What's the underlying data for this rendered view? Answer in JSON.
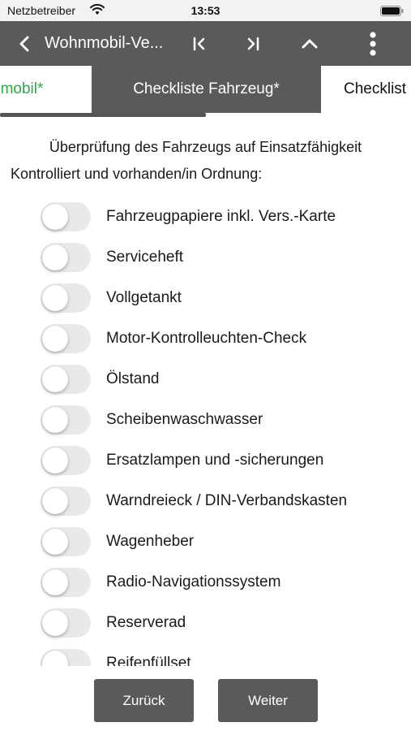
{
  "status_bar": {
    "carrier": "Netzbetreiber",
    "time": "13:53"
  },
  "toolbar": {
    "title": "Wohnmobil-Ve...",
    "icons": [
      "back-chevron-icon",
      "first-page-icon",
      "last-page-icon",
      "collapse-icon",
      "more-vertical-icon"
    ]
  },
  "tabs": [
    {
      "label": "nmobil*",
      "color": "#2ea84a"
    },
    {
      "label": "Checkliste Fahrzeug*",
      "selected": true
    },
    {
      "label": "Checklist"
    }
  ],
  "content": {
    "heading": "Überprüfung des Fahrzeugs auf Einsatzfähigkeit",
    "subheading": "Kontrolliert und vorhanden/in Ordnung:",
    "items": [
      {
        "label": "Fahrzeugpapiere inkl. Vers.-Karte",
        "checked": false
      },
      {
        "label": "Serviceheft",
        "checked": false
      },
      {
        "label": "Vollgetankt",
        "checked": false
      },
      {
        "label": "Motor-Kontrolleuchten-Check",
        "checked": false
      },
      {
        "label": "Ölstand",
        "checked": false
      },
      {
        "label": "Scheibenwaschwasser",
        "checked": false
      },
      {
        "label": "Ersatzlampen und -sicherungen",
        "checked": false
      },
      {
        "label": "Warndreieck / DIN-Verbandskasten",
        "checked": false
      },
      {
        "label": "Wagenheber",
        "checked": false
      },
      {
        "label": "Radio-Navigationssystem",
        "checked": false
      },
      {
        "label": "Reserverad",
        "checked": false
      },
      {
        "label": "Reifenfüllset",
        "checked": false
      }
    ]
  },
  "footer": {
    "back_label": "Zurück",
    "next_label": "Weiter"
  },
  "colors": {
    "toolbar": "#5a5a5a",
    "accent_green": "#2ea84a",
    "toggle_off": "#e9e9ea"
  }
}
